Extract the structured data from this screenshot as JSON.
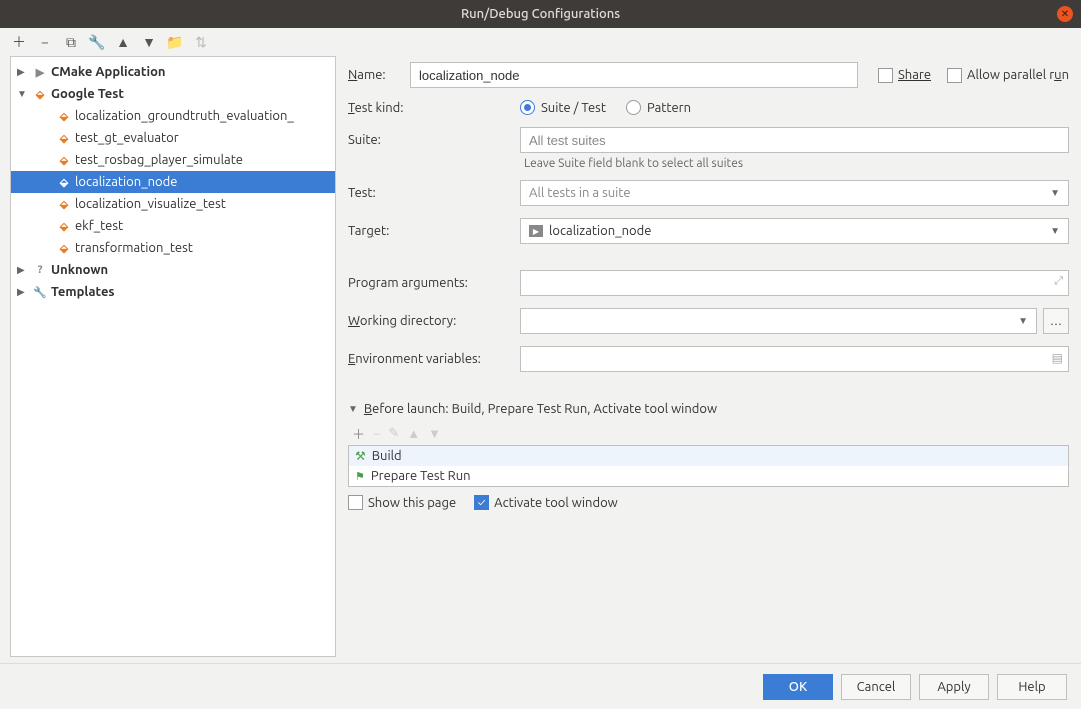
{
  "window": {
    "title": "Run/Debug Configurations"
  },
  "tree": {
    "groups": [
      {
        "label": "CMake Application",
        "expanded": false,
        "icon": "play"
      },
      {
        "label": "Google Test",
        "expanded": true,
        "icon": "gt",
        "children": [
          {
            "label": "localization_groundtruth_evaluation_"
          },
          {
            "label": "test_gt_evaluator"
          },
          {
            "label": "test_rosbag_player_simulate"
          },
          {
            "label": "localization_node",
            "selected": true
          },
          {
            "label": "localization_visualize_test"
          },
          {
            "label": "ekf_test"
          },
          {
            "label": "transformation_test"
          }
        ]
      },
      {
        "label": "Unknown",
        "expanded": false,
        "icon": "question"
      },
      {
        "label": "Templates",
        "expanded": false,
        "icon": "wrench"
      }
    ]
  },
  "form": {
    "name_label": "Name:",
    "name_value": "localization_node",
    "share_label": "Share",
    "parallel_label": "Allow parallel run",
    "testkind_label": "Test kind:",
    "radio_suite": "Suite / Test",
    "radio_pattern": "Pattern",
    "suite_label": "Suite:",
    "suite_placeholder": "All test suites",
    "suite_hint": "Leave Suite field blank to select all suites",
    "test_label": "Test:",
    "test_placeholder": "All tests in a suite",
    "target_label": "Target:",
    "target_value": "localization_node",
    "progargs_label": "Program arguments:",
    "workdir_label": "Working directory:",
    "envvars_label": "Environment variables:",
    "before_launch_label": "Before launch: Build, Prepare Test Run, Activate tool window",
    "launch_items": [
      {
        "label": "Build",
        "icon": "hammer"
      },
      {
        "label": "Prepare Test Run",
        "icon": "flag"
      }
    ],
    "show_page_label": "Show this page",
    "activate_tool_label": "Activate tool window"
  },
  "buttons": {
    "ok": "OK",
    "cancel": "Cancel",
    "apply": "Apply",
    "help": "Help"
  }
}
